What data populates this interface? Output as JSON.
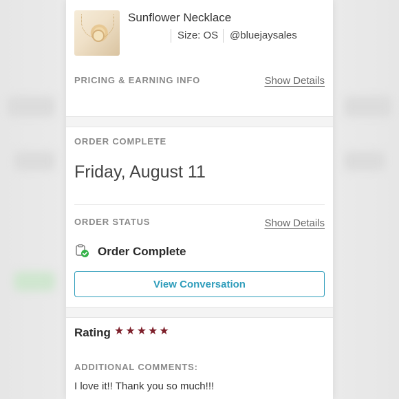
{
  "item": {
    "title": "Sunflower Necklace",
    "size": "Size: OS",
    "seller": "@bluejaysales"
  },
  "pricing": {
    "label": "PRICING & EARNING INFO",
    "link": "Show Details"
  },
  "order_complete": {
    "label": "ORDER COMPLETE",
    "date": "Friday, August 11"
  },
  "order_status": {
    "label": "ORDER STATUS",
    "link": "Show Details",
    "status": "Order Complete",
    "status_icon": "order-complete-check-icon"
  },
  "conversation_button": "View Conversation",
  "rating": {
    "label": "Rating",
    "stars": 5,
    "star_color": "#7d1f2a"
  },
  "comments": {
    "label": "ADDITIONAL COMMENTS:",
    "text": "I love it!! Thank you so much!!!"
  },
  "colors": {
    "accent": "#2f9dbb",
    "status_green": "#35b34a"
  }
}
